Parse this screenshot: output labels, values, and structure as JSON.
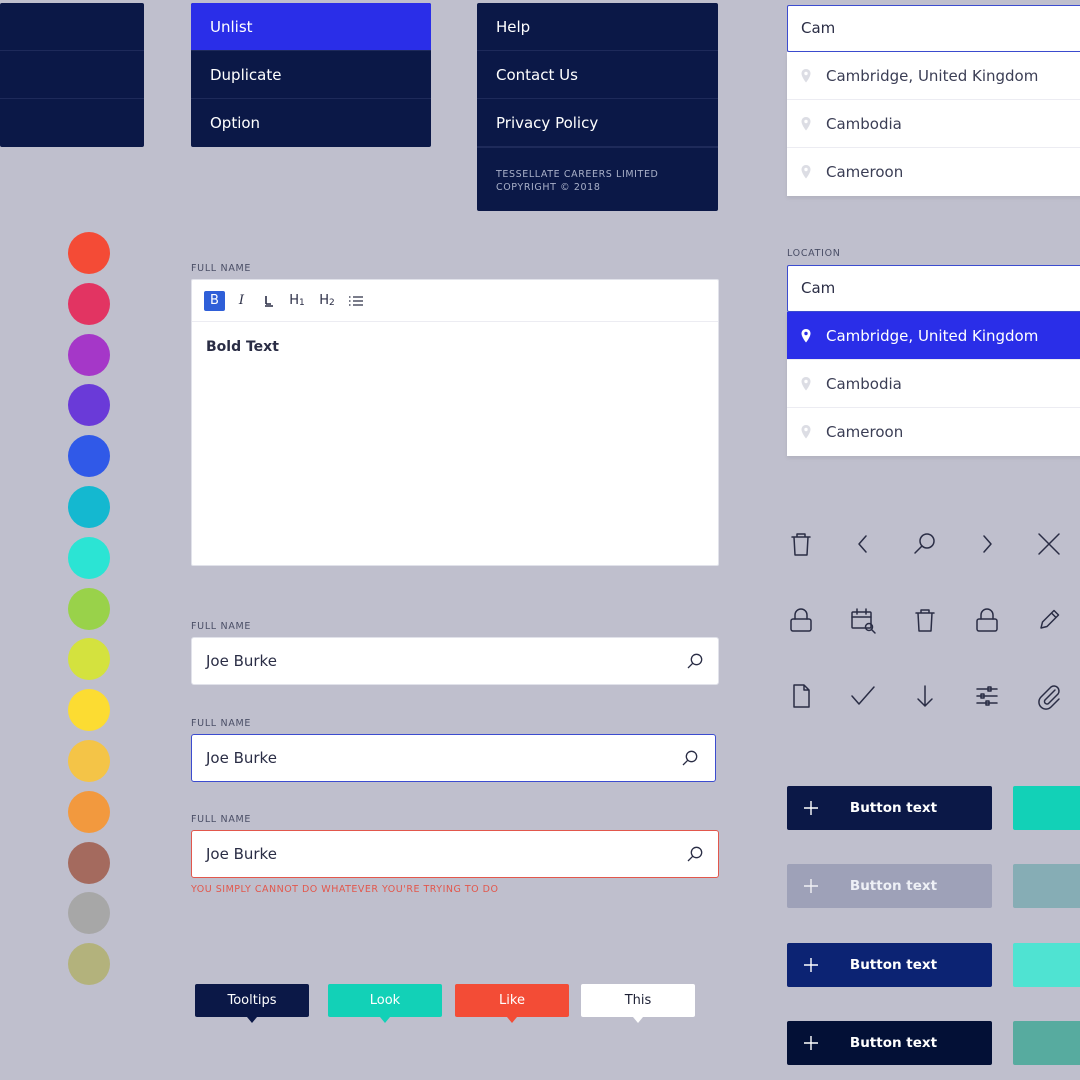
{
  "menus": {
    "left_partial": {
      "items": [
        "",
        "",
        ""
      ]
    },
    "actions": {
      "items": [
        "Unlist",
        "Duplicate",
        "Option"
      ],
      "active": "Unlist"
    },
    "footer": {
      "items": [
        "Help",
        "Contact Us",
        "Privacy Policy"
      ],
      "company": "TESSELLATE CAREERS LIMITED",
      "copyright": "COPYRIGHT © 2018"
    }
  },
  "palette": [
    "#f44b36",
    "#e23462",
    "#a537c8",
    "#6a3ad8",
    "#3059e8",
    "#14b8d0",
    "#2be4d4",
    "#99d24a",
    "#d4e23e",
    "#fcdc32",
    "#f4c447",
    "#f2993e",
    "#a46a5e",
    "#a7a7a7",
    "#b3b27c"
  ],
  "editor": {
    "label": "FULL NAME",
    "toolbar": [
      "B",
      "I",
      "",
      "H1",
      "H2",
      "list"
    ],
    "content": "Bold Text"
  },
  "fields": [
    {
      "label": "FULL NAME",
      "value": "Joe Burke",
      "state": "default"
    },
    {
      "label": "FULL NAME",
      "value": "Joe Burke",
      "state": "focus"
    },
    {
      "label": "FULL NAME",
      "value": "Joe Burke",
      "state": "error",
      "error": "YOU SIMPLY CANNOT DO WHATEVER YOU'RE TRYING TO DO"
    }
  ],
  "tooltips": [
    {
      "text": "Tooltips",
      "bg": "#0b1847",
      "fg": "#ffffff"
    },
    {
      "text": "Look",
      "bg": "#12d1b7",
      "fg": "#ffffff"
    },
    {
      "text": "Like",
      "bg": "#f34c36",
      "fg": "#ffffff"
    },
    {
      "text": "This",
      "bg": "#ffffff",
      "fg": "#1b1e33"
    }
  ],
  "autocomplete_1": {
    "query": "Cam",
    "options": [
      "Cambridge, United Kingdom",
      "Cambodia",
      "Cameroon"
    ]
  },
  "autocomplete_2": {
    "label": "LOCATION",
    "query": "Cam",
    "options": [
      "Cambridge, United Kingdom",
      "Cambodia",
      "Cameroon"
    ],
    "selected": "Cambridge, United Kingdom"
  },
  "icons": [
    "trash-icon",
    "chevron-left-icon",
    "search-icon",
    "chevron-right-icon",
    "close-icon",
    "lock-icon",
    "calendar-search-icon",
    "trash-icon",
    "lock-icon",
    "pencil-icon",
    "document-icon",
    "check-icon",
    "arrow-down-icon",
    "sliders-icon",
    "paperclip-icon"
  ],
  "buttons": [
    {
      "label": "Button text",
      "bg": "#0b1847",
      "swatch": "#12d1b7"
    },
    {
      "label": "Button text",
      "bg": "#9ea1b8",
      "swatch": "#86adb5"
    },
    {
      "label": "Button text",
      "bg": "#0c2373",
      "swatch": "#4fe3d2"
    },
    {
      "label": "Button text",
      "bg": "#031036",
      "swatch": "#57ab9f"
    }
  ]
}
